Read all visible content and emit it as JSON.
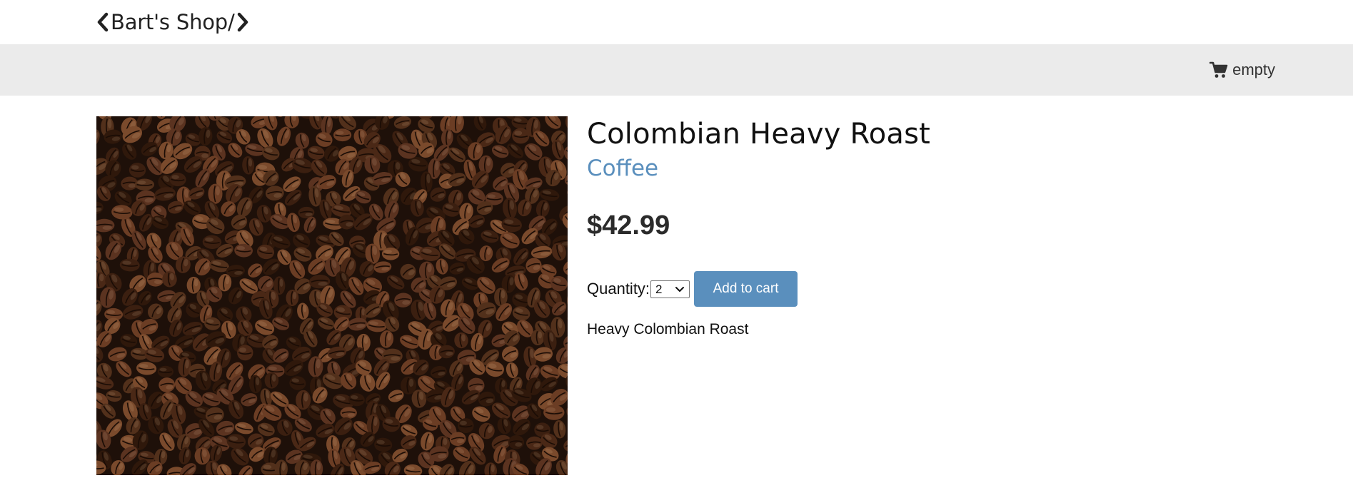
{
  "brand": {
    "name": "Bart's Shop/"
  },
  "nav": {
    "cart_label": "empty",
    "cart_icon": "shopping-cart-icon"
  },
  "product": {
    "title": "Colombian Heavy Roast",
    "category": "Coffee",
    "price": "$42.99",
    "quantity_label": "Quantity:",
    "quantity_value": "2",
    "add_to_cart_label": "Add to cart",
    "description": "Heavy Colombian Roast",
    "image": "coffee-beans-photo"
  },
  "colors": {
    "accent": "#5a8fbd",
    "nav_background": "#ebebeb",
    "text": "#333333"
  }
}
